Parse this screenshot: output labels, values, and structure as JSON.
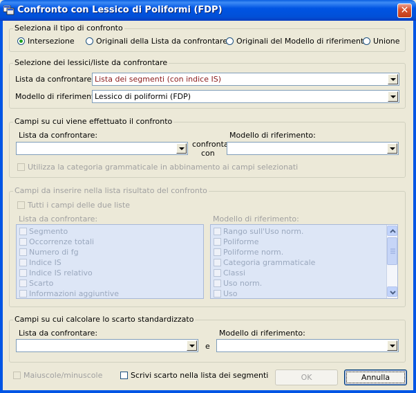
{
  "window": {
    "title": "Confronto con Lessico di Poliformi (FDP)",
    "close_glyph": "✕"
  },
  "tipo_confronto": {
    "legend": "Seleziona il tipo di confronto",
    "options": [
      "Intersezione",
      "Originali della Lista da confrontare",
      "Originali del Modello di riferimento",
      "Unione"
    ],
    "selected": "Intersezione"
  },
  "selezione_lessici": {
    "legend": "Selezione dei lessici/liste da confrontare",
    "lista_label": "Lista da confrontare:",
    "lista_value": "Lista dei segmenti (con indice IS)",
    "modello_label": "Modello di riferimento:",
    "modello_value": "Lessico di poliformi (FDP)"
  },
  "campi_confronto": {
    "legend": "Campi su cui viene effettuato il confronto",
    "lista_label": "Lista da confrontare:",
    "lista_value": "",
    "connector_1": "confronta",
    "connector_2": "con",
    "modello_label": "Modello di riferimento:",
    "modello_value": "",
    "checkbox_label": "Utilizza la categoria grammaticale in abbinamento ai campi selezionati"
  },
  "campi_risultato": {
    "legend": "Campi da inserire nella lista risultato del confronto",
    "tutti_label": "Tutti i campi delle due liste",
    "lista_label": "Lista da confrontare:",
    "lista_items": [
      "Segmento",
      "Occorrenze totali",
      "Numero di fg",
      "Indice IS",
      "Indice IS relativo",
      "Scarto",
      "Informazioni aggiuntive"
    ],
    "modello_label": "Modello di riferimento:",
    "modello_items": [
      "Rango sull'Uso norm.",
      "Poliforme",
      "Poliforme norm.",
      "Categoria grammaticale",
      "Classi",
      "Uso norm.",
      "Uso"
    ]
  },
  "scarto": {
    "legend": "Campi su cui calcolare lo scarto standardizzato",
    "lista_label": "Lista da confrontare:",
    "lista_value": "",
    "connector": "e",
    "modello_label": "Modello di riferimento:",
    "modello_value": ""
  },
  "footer": {
    "maiuscole_label": "Maiuscole/minuscole",
    "scrivi_label": "Scrivi scarto nella lista dei segmenti",
    "ok_label": "OK",
    "annulla_label": "Annulla"
  },
  "colors": {
    "title_bar": "#0054e3",
    "dialog_bg": "#ece9d8",
    "radio_dot": "#21a121",
    "close_button": "#d9542f"
  }
}
